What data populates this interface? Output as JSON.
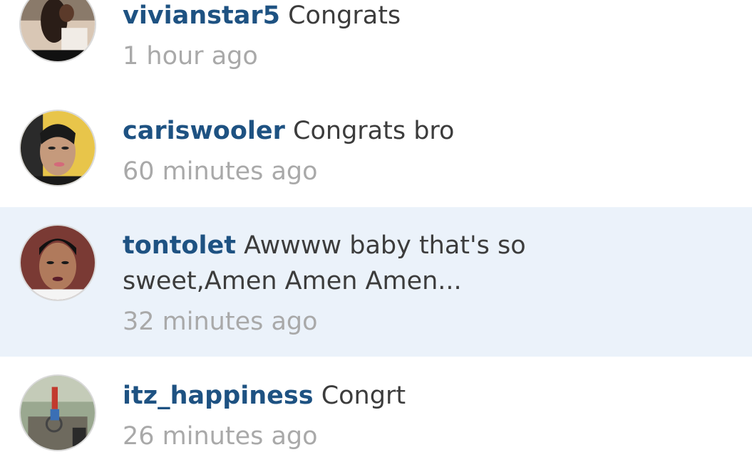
{
  "comments": [
    {
      "username": "vivianstar5",
      "text": "Congrats",
      "time": "1 hour ago",
      "highlighted": false,
      "avatar_icon": "user-avatar-photo"
    },
    {
      "username": "cariswooler",
      "text": "Congrats bro",
      "time": "60 minutes ago",
      "highlighted": false,
      "avatar_icon": "user-avatar-photo"
    },
    {
      "username": "tontolet",
      "text": "Awwww baby that's so sweet,Amen Amen Amen...",
      "time": "32 minutes ago",
      "highlighted": true,
      "avatar_icon": "user-avatar-photo"
    },
    {
      "username": "itz_happiness",
      "text": "Congrt",
      "time": "26 minutes ago",
      "highlighted": false,
      "avatar_icon": "user-avatar-photo"
    }
  ],
  "colors": {
    "username": "#1e5282",
    "comment_text": "#3c3c3c",
    "timestamp": "#a9a9a9",
    "highlight_row": "#ebf2fa",
    "background": "#ffffff"
  }
}
